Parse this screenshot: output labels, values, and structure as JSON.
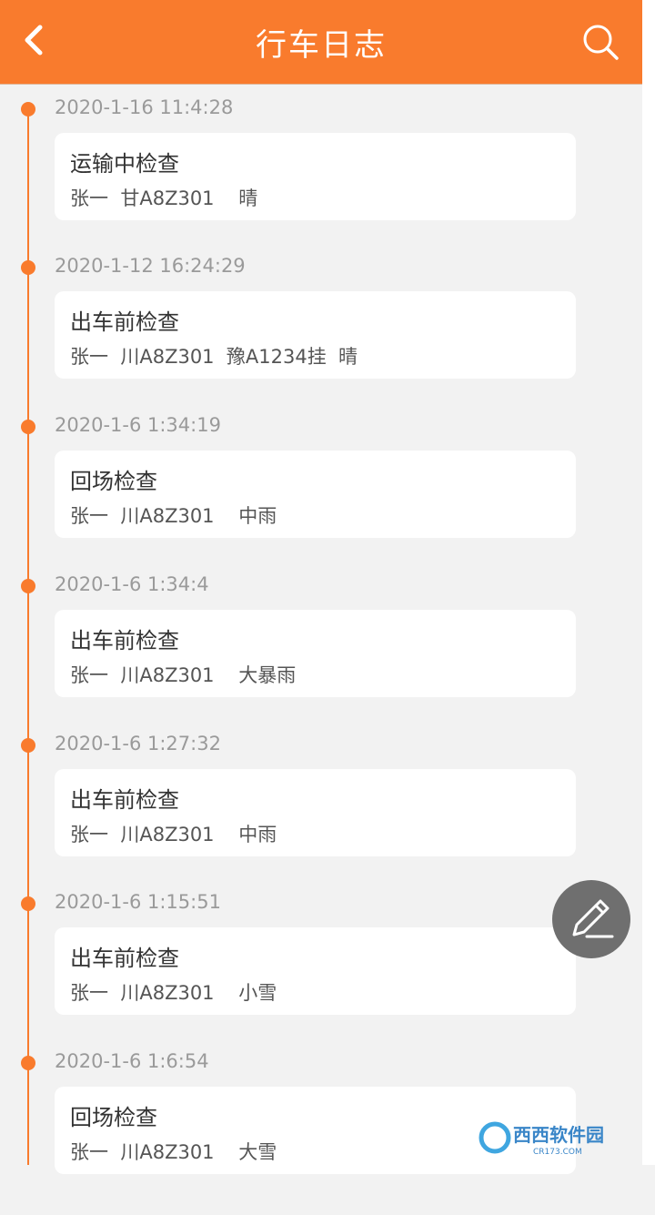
{
  "header": {
    "title": "行车日志"
  },
  "entries": [
    {
      "time": "2020-1-16 11:4:28",
      "type": "运输中检查",
      "detail": "张一  甘A8Z301    晴"
    },
    {
      "time": "2020-1-12 16:24:29",
      "type": "出车前检查",
      "detail": "张一  川A8Z301  豫A1234挂  晴"
    },
    {
      "time": "2020-1-6 1:34:19",
      "type": "回场检查",
      "detail": "张一  川A8Z301    中雨"
    },
    {
      "time": "2020-1-6 1:34:4",
      "type": "出车前检查",
      "detail": "张一  川A8Z301    大暴雨"
    },
    {
      "time": "2020-1-6 1:27:32",
      "type": "出车前检查",
      "detail": "张一  川A8Z301    中雨"
    },
    {
      "time": "2020-1-6 1:15:51",
      "type": "出车前检查",
      "detail": "张一  川A8Z301    小雪"
    },
    {
      "time": "2020-1-6 1:6:54",
      "type": "回场检查",
      "detail": "张一  川A8Z301    大雪"
    }
  ],
  "watermark": {
    "text": "西西软件园",
    "domain": "CR173.COM"
  },
  "colors": {
    "accent": "#f97b2d",
    "background": "#f2f2f2",
    "card": "#ffffff",
    "fab": "#6f6f6f"
  },
  "icons": {
    "back": "chevron-left-icon",
    "search": "search-icon",
    "fab": "pencil-icon"
  }
}
